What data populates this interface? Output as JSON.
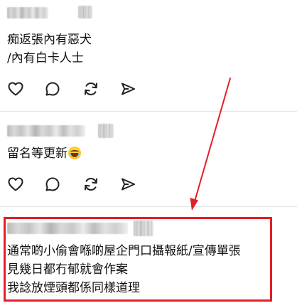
{
  "posts": [
    {
      "id": "post-1",
      "lines": [
        "痴返張內有惡犬",
        "/內有白卡人士"
      ]
    },
    {
      "id": "post-2",
      "lines": [
        "留名等更新"
      ],
      "emoji": "rolling-on-floor-laughing-emoji"
    },
    {
      "id": "post-3",
      "lines": [
        "通常啲小偷會喺啲屋企門口攝報紙/宣傳單張",
        "見幾日都冇郁就會作案",
        "我諗放煙頭都係同樣道理"
      ]
    }
  ],
  "actions": {
    "like_icon": "heart-icon",
    "reply_icon": "speech-bubble-icon",
    "repost_icon": "repost-icon",
    "share_icon": "send-icon"
  },
  "annotation": {
    "color": "#e41e26"
  }
}
